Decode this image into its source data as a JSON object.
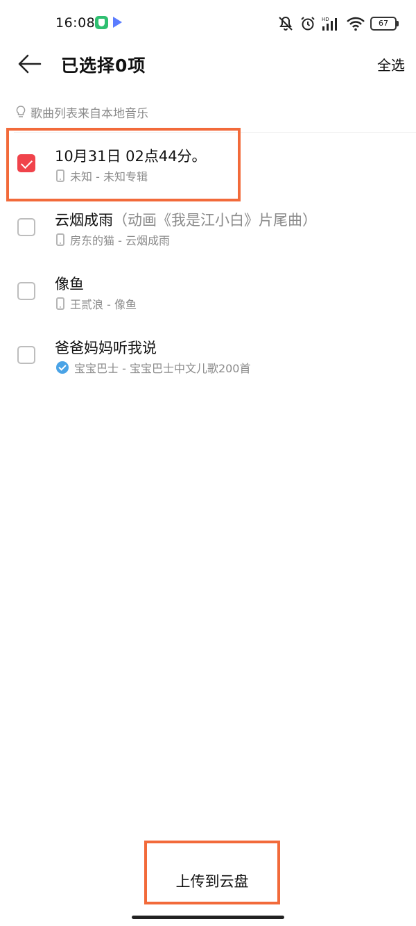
{
  "status_bar": {
    "time": "16:08",
    "battery": "67",
    "icons": [
      "shield-app-icon",
      "play-app-icon",
      "mute-icon",
      "alarm-icon",
      "hd-signal-icon",
      "wifi-icon",
      "battery-icon"
    ]
  },
  "header": {
    "title": "已选择0项",
    "select_all": "全选",
    "back_icon": "arrow-left-icon"
  },
  "hint": {
    "icon": "lightbulb-icon",
    "text": "歌曲列表来自本地音乐"
  },
  "songs": [
    {
      "title": "10月31日 02点44分。",
      "subtitle": "",
      "meta": "未知 - 未知专辑",
      "icon": "device-icon",
      "checked": true
    },
    {
      "title": "云烟成雨",
      "subtitle": "（动画《我是江小白》片尾曲）",
      "meta": "房东的猫 - 云烟成雨",
      "icon": "device-icon",
      "checked": false
    },
    {
      "title": "像鱼",
      "subtitle": "",
      "meta": "王贰浪 - 像鱼",
      "icon": "device-icon",
      "checked": false
    },
    {
      "title": "爸爸妈妈听我说",
      "subtitle": "",
      "meta": "宝宝巴士 - 宝宝巴士中文儿歌200首",
      "icon": "verified-icon",
      "checked": false
    }
  ],
  "footer": {
    "upload_label": "上传到云盘"
  },
  "colors": {
    "accent": "#f0434b",
    "highlight": "#f26a3a",
    "secondary_text": "#8a8a8a"
  }
}
